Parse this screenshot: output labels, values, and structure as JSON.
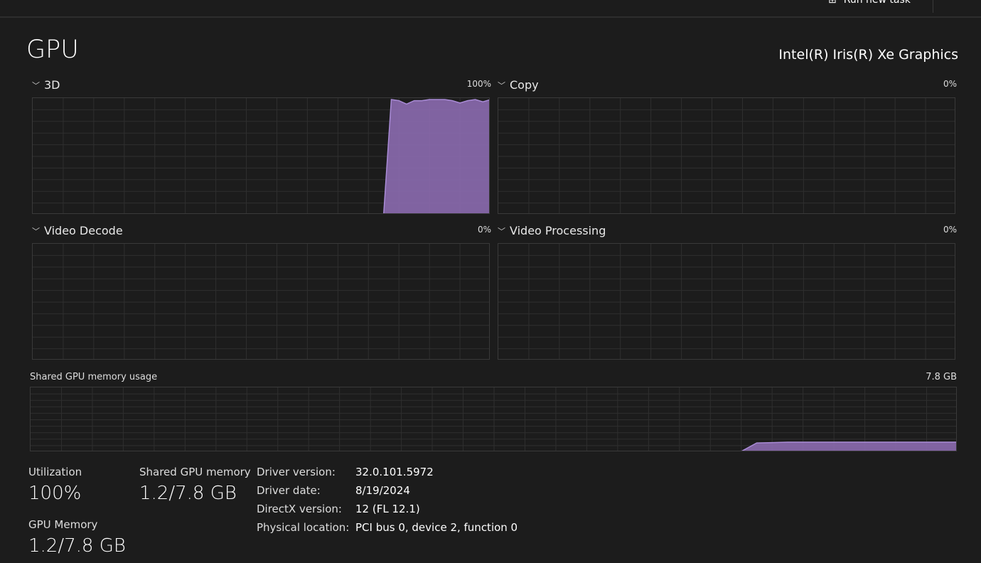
{
  "toolbar": {
    "run_new_task": "Run new task",
    "run_icon": "run-task-icon"
  },
  "header": {
    "title": "GPU",
    "device": "Intel(R) Iris(R) Xe Graphics"
  },
  "colors": {
    "accent": "#8c6cb0",
    "line": "#a98bd6",
    "grid": "#2f2f2f"
  },
  "engines": [
    {
      "name": "3D",
      "percent": "100%",
      "values": [
        0,
        0,
        0,
        0,
        0,
        0,
        0,
        0,
        0,
        0,
        0,
        0,
        0,
        0,
        0,
        0,
        0,
        0,
        0,
        0,
        0,
        0,
        0,
        0,
        0,
        0,
        0,
        0,
        0,
        0,
        0,
        0,
        0,
        0,
        0,
        0,
        0,
        0,
        0,
        0,
        0,
        0,
        0,
        0,
        0,
        0,
        0,
        100,
        99,
        96,
        99,
        99,
        100,
        100,
        100,
        99,
        97,
        99,
        100,
        98,
        100
      ]
    },
    {
      "name": "Copy",
      "percent": "0%",
      "values": []
    },
    {
      "name": "Video Decode",
      "percent": "0%",
      "values": []
    },
    {
      "name": "Video Processing",
      "percent": "0%",
      "values": []
    }
  ],
  "shared_memory_chart": {
    "label": "Shared GPU memory usage",
    "max": "7.8 GB",
    "max_gb": 7.8,
    "values": [
      0,
      0,
      0,
      0,
      0,
      0,
      0,
      0,
      0,
      0,
      0,
      0,
      0,
      0,
      0,
      0,
      0,
      0,
      0,
      0,
      0,
      0,
      0,
      0,
      0,
      0,
      0,
      0,
      0,
      0,
      0,
      0,
      0,
      0,
      0,
      0,
      0,
      0,
      0,
      0,
      0,
      0,
      0,
      0,
      0,
      0,
      0,
      1.05,
      1.1,
      1.15,
      1.15,
      1.15,
      1.15,
      1.15,
      1.15,
      1.15,
      1.15,
      1.15,
      1.15,
      1.15,
      1.15
    ]
  },
  "stats": {
    "utilization_label": "Utilization",
    "utilization": "100%",
    "shared_label": "Shared GPU memory",
    "shared": "1.2/7.8 GB",
    "gpumem_label": "GPU Memory",
    "gpumem": "1.2/7.8 GB"
  },
  "details": [
    {
      "k": "Driver version:",
      "v": "32.0.101.5972"
    },
    {
      "k": "Driver date:",
      "v": "8/19/2024"
    },
    {
      "k": "DirectX version:",
      "v": "12 (FL 12.1)"
    },
    {
      "k": "Physical location:",
      "v": "PCI bus 0, device 2, function 0"
    }
  ]
}
